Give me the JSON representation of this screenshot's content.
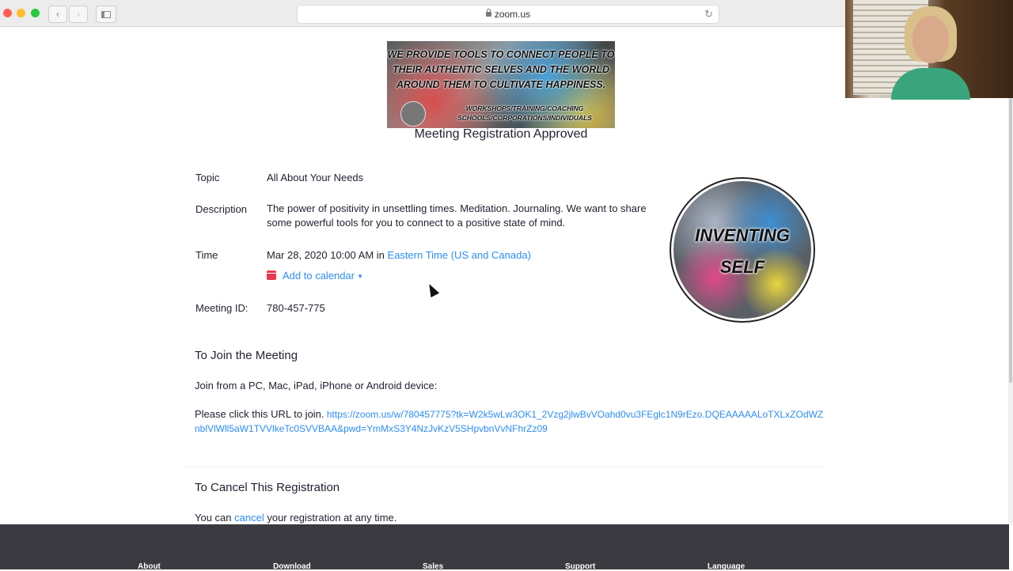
{
  "browser": {
    "url": "zoom.us",
    "back": "‹",
    "forward": "›",
    "reload": "↻"
  },
  "banner": {
    "line1": "WE PROVIDE TOOLS TO CONNECT PEOPLE TO",
    "line2": "THEIR AUTHENTIC SELVES AND THE WORLD",
    "line3": "AROUND THEM TO CULTIVATE HAPPINESS.",
    "line4": "WORKSHOPS/TRAINING/COACHING",
    "line5": "SCHOOLS/CORPORATIONS/INDIVIDUALS"
  },
  "page": {
    "title": "Meeting Registration Approved"
  },
  "details": {
    "topic_label": "Topic",
    "topic": "All About Your Needs",
    "description_label": "Description",
    "description": "The power of positivity in unsettling times. Meditation. Journaling. We want to share some powerful tools for you to connect to a positive state of mind.",
    "time_label": "Time",
    "time": "Mar 28, 2020 10:00 AM",
    "time_in": "in",
    "timezone": "Eastern Time (US and Canada)",
    "add_to_calendar": "Add to calendar",
    "meeting_id_label": "Meeting ID:",
    "meeting_id": "780-457-775"
  },
  "seal": {
    "line1": "INVENTING",
    "line2": "SELF"
  },
  "join": {
    "heading": "To Join the Meeting",
    "devices": "Join from a PC, Mac, iPad, iPhone or Android device:",
    "click_prefix": "Please click this URL to join.",
    "url": "https://zoom.us/w/780457775?tk=W2k5wLw3OK1_2Vzg2jlwBvVOahd0vu3FEglc1N9rEzo.DQEAAAAALoTXLxZOdWZnblVlWll5aW1TVVlkeTc0SVVBAA&pwd=YmMxS3Y4NzJvKzV5SHpvbnVvNFhrZz09"
  },
  "cancel": {
    "heading": "To Cancel This Registration",
    "prefix": "You can",
    "link": "cancel",
    "suffix": "your registration at any time."
  },
  "footer": {
    "cols": [
      "About",
      "Download",
      "Sales",
      "Support",
      "Language"
    ]
  },
  "colors": {
    "link": "#2d8cff",
    "footer_bg": "#3a3a40",
    "calendar_icon": "#e8384f"
  }
}
